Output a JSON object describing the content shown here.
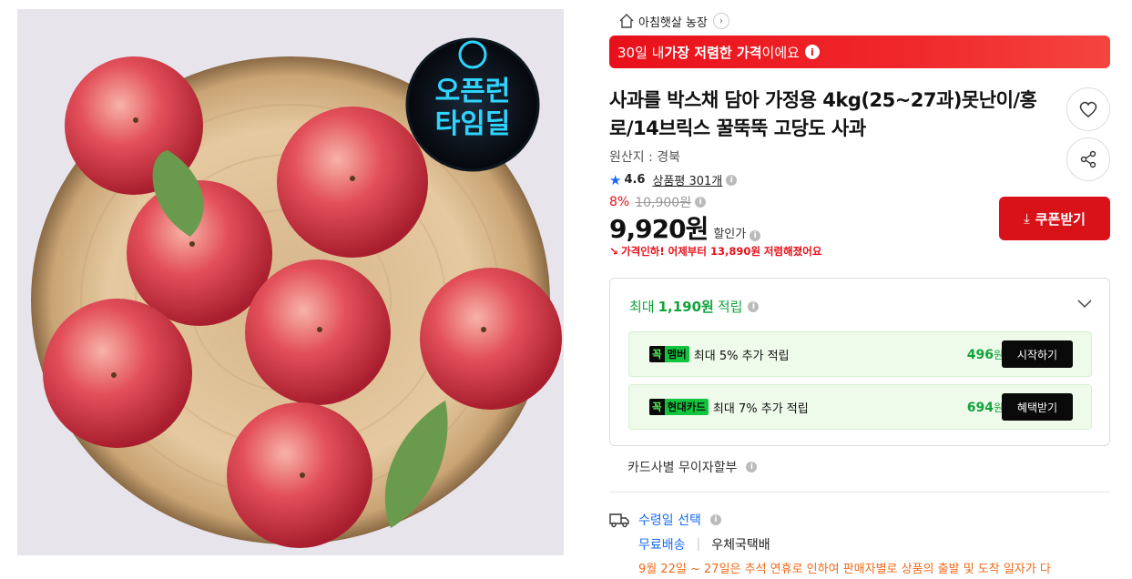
{
  "product_image": {
    "badge_line1": "오픈런",
    "badge_line2": "타임딜"
  },
  "seller": {
    "name": "아침햇살 농장"
  },
  "banner": {
    "prefix": "30일 내 ",
    "bold": "가장 저렴한 가격",
    "suffix": "이에요"
  },
  "product": {
    "title": "사과를 박스채 담아 가정용 4kg(25~27과)못난이/홍로/14브릭스 꿀뚝뚝 고당도 사과",
    "origin": "원산지 : 경북"
  },
  "rating": {
    "score": "4.6",
    "reviews": "상품평 301개"
  },
  "price": {
    "discount_pct": "8%",
    "original": "10,900원",
    "sale": "9,920원",
    "sale_label": "할인가",
    "drop_notice": "가격인하! 어제부터 13,890원 저렴해졌어요"
  },
  "coupon": {
    "label": "쿠폰받기"
  },
  "rewards": {
    "header_prefix": "최대",
    "header_amount": "1,190원",
    "header_suffix": "적립",
    "items": [
      {
        "tag_k": "꼭",
        "tag_t": "멤버",
        "text": "최대 5% 추가 적립",
        "amount": "496",
        "unit": "원",
        "button": "시작하기"
      },
      {
        "tag_k": "꼭",
        "tag_t": "현대카드",
        "text": "최대 7% 추가 적립",
        "amount": "694",
        "unit": "원",
        "button": "혜택받기"
      }
    ]
  },
  "installment": {
    "label": "카드사별 무이자할부"
  },
  "delivery": {
    "label": "수령일 선택",
    "free": "무료배송",
    "carrier": "우체국택배",
    "notice": "9월 22일 ~ 27일은 추석 연휴로 인하여 판매자별로 상품의 출발 및 도착 일자가 다"
  },
  "colors": {
    "accent_red": "#e8101a",
    "green": "#11a33b",
    "blue": "#1a6cf3"
  }
}
